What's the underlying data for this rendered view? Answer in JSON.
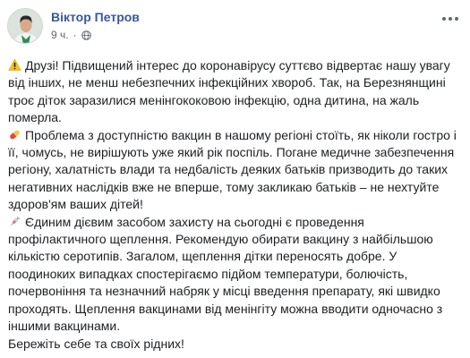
{
  "post": {
    "author": "Віктор Петров",
    "time": "9 ч.",
    "separator": "·",
    "privacy_icon": "globe-icon",
    "menu_icon": "more-options-icon",
    "paragraphs": [
      {
        "emoji": "warning-icon",
        "text": "Друзі! Підвищений інтерес до коронавірусу суттєво відвертає нашу увагу від інших, не менш небезпечних інфекційних хвороб. Так, на Березнянщині троє діток заразилися менінгококовою інфекцію, одна дитина, на жаль померла."
      },
      {
        "emoji": "pill-icon",
        "text": "Проблема з доступністю вакцин в нашому регіоні стоїть, як ніколи гостро і її, чомусь, не вирішують уже який рік поспіль. Погане медичне забезпечення регіону, халатність влади та недбалість деяких батьків призводить до таких негативних наслідків вже не вперше, тому закликаю батьків – не нехтуйте здоров'ям ваших дітей!"
      },
      {
        "emoji": "syringe-icon",
        "text": "Єдиним дієвим засобом захисту на сьогодні є проведення профілактичного щеплення. Рекомендую обирати вакцину з найбільшою кількістю серотипів. Загалом, щеплення дітки переносять добре. У поодиноких випадках спостерігаємо підйом температури, болючість, почервоніння та незначний набряк у місці введення препарату, які швидко проходять. Щеплення вакцинами від менінгіту можна вводити одночасно з іншими вакцинами."
      },
      {
        "emoji": "",
        "text": "Бережіть себе та своїх рідних!"
      }
    ]
  }
}
